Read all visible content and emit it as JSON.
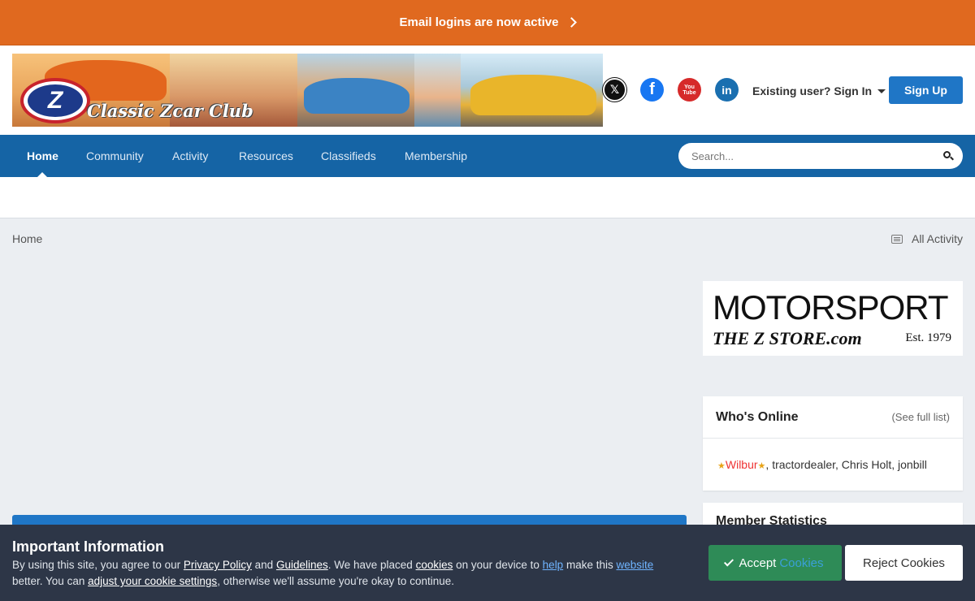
{
  "announcement": {
    "text": "Email logins are now active"
  },
  "header": {
    "logo_text": "Classic Zcar Club",
    "badge_letter": "Z",
    "social_icons": [
      "x-icon",
      "facebook-icon",
      "youtube-icon",
      "linkedin-icon"
    ],
    "social_glyphs": {
      "x": "𝕏",
      "facebook": "f",
      "youtube_top": "You",
      "youtube_bottom": "Tube",
      "linkedin": "in"
    },
    "signin_label": "Existing user? Sign In",
    "signup_label": "Sign Up"
  },
  "nav": {
    "items": [
      {
        "label": "Home",
        "active": true
      },
      {
        "label": "Community"
      },
      {
        "label": "Activity"
      },
      {
        "label": "Resources"
      },
      {
        "label": "Classifieds"
      },
      {
        "label": "Membership"
      }
    ],
    "search_placeholder": "Search..."
  },
  "breadcrumb": {
    "home": "Home",
    "all_activity": "All Activity"
  },
  "ad": {
    "line1": "MOTORSPORT",
    "line2": "THE Z STORE.com",
    "line3": "Est. 1979"
  },
  "whos_online": {
    "title": "Who's Online",
    "see_full": "(See full list)",
    "star": "★",
    "highlight_user": "Wilbur",
    "others": ", tractordealer, Chris Holt, jonbill"
  },
  "member_stats": {
    "title": "Member Statistics"
  },
  "cookie": {
    "title": "Important Information",
    "t1": "By using this site, you agree to our ",
    "privacy": "Privacy Policy",
    "t2": " and ",
    "guidelines": "Guidelines",
    "t3": ". We have placed ",
    "cookies": "cookies",
    "t4": " on your device to ",
    "help": "help",
    "t5": " make this ",
    "website": "website",
    "t6": " better. You can ",
    "adjust": "adjust your cookie settings",
    "t7": ", otherwise we'll assume you're okay to continue.",
    "accept_label": "Accept",
    "accept_suffix": "Cookies",
    "reject_label": "Reject Cookies"
  }
}
